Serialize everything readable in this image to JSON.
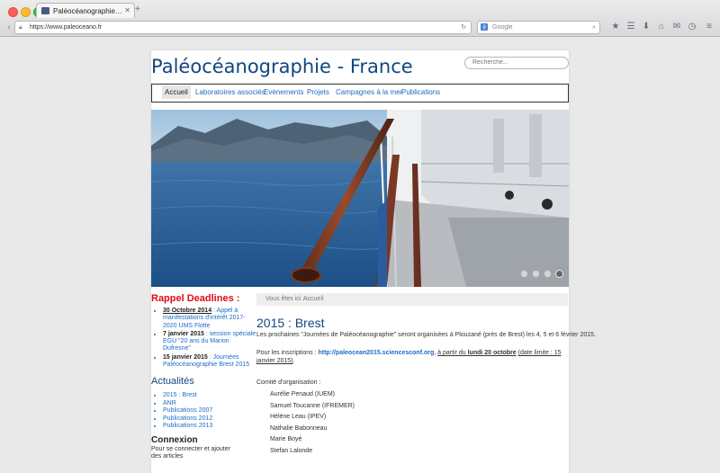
{
  "browser": {
    "tab_title": "Paléocéanographie – Fran...",
    "url": "https://www.paleoceano.fr",
    "search_placeholder": "Google"
  },
  "site": {
    "title": "Paléocéanographie - France",
    "search_placeholder": "Recherche..."
  },
  "menu": [
    "Accueil",
    "Laboratoires associés",
    "Evènements",
    "Projets",
    "Campagnes à la mer",
    "Publications"
  ],
  "slider": {
    "slides": 4,
    "active_index": 3
  },
  "sidebar": {
    "rappel_title": "Rappel Deadlines :",
    "deadlines": [
      {
        "date": "30 Octobre 2014",
        "text": " : Appel à manifestations d'intérêt 2017-2020 UMS Flotte"
      },
      {
        "date": "7 janvier 2015",
        "text": " : session spéciale EGU \"20 ans du Marion Dufresne\""
      },
      {
        "date": "15 janvier 2015",
        "text": " : Journées Paléocéanographie Brest 2015"
      }
    ],
    "actualites_title": "Actualités",
    "actualites": [
      "2015 : Brest",
      "ANR",
      "Publications 2007",
      "Publications 2012",
      "Publications 2013"
    ],
    "connexion_title": "Connexion",
    "connexion_text": "Pour se connecter et ajouter des articles"
  },
  "breadcrumb": {
    "label": "Vous êtes ici :",
    "value": "Accueil"
  },
  "article": {
    "title": "2015 : Brest",
    "p1": "Les prochaines \"Journées de Paléocéanographie\" seront organisées à Plouzané (près de Brest) les 4, 5 et 6 février 2015.",
    "p2_prefix": "Pour les inscriptions : ",
    "p2_link": "http://paleocean2015.sciencesconf.org",
    "p2_mid": ", ",
    "p2_deadline_prefix": "à partir du ",
    "p2_deadline_date": "lundi 20 octobre",
    "p2_limit": "(date limite : 15 janvier 2015)",
    "p2_end": ".",
    "committee_title": "Comité d'organisation :",
    "members": [
      "Aurélie Penaud (IUEM)",
      "Samuel Toucanne (IFREMER)",
      "Hélène Leau (IPEV)",
      "Nathalie Babonneau",
      "Marie Boyé",
      "Stefan Lalonde"
    ]
  },
  "colors": {
    "brand": "#11477e",
    "link": "#1b6cc6",
    "alert": "#e10a16"
  }
}
